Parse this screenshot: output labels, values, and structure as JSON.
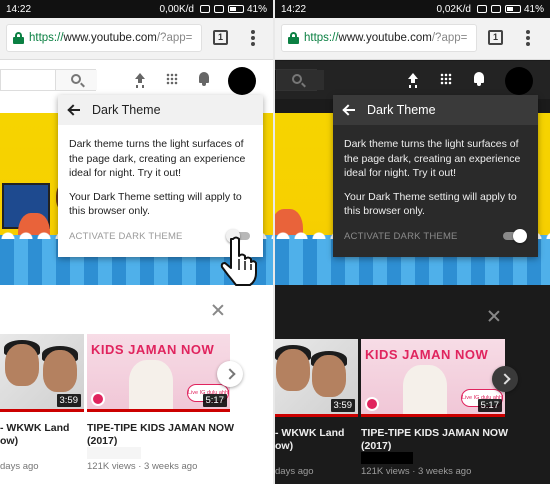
{
  "status_left": {
    "time": "14:22",
    "net_speed": "0,00K/d",
    "battery": "41%"
  },
  "status_right": {
    "time": "14:22",
    "net_speed": "0,02K/d",
    "battery": "41%"
  },
  "browser": {
    "url_scheme": "https://",
    "url_host": "www.youtube.com",
    "url_path": "/?app=",
    "tab_count": "1"
  },
  "popup": {
    "title": "Dark Theme",
    "body_1": "Dark theme turns the light surfaces of the page dark, creating an experience ideal for night. Try it out!",
    "body_2": "Your Dark Theme setting will apply to this browser only.",
    "toggle_label": "ACTIVATE DARK THEME"
  },
  "toggle_state": {
    "left": "off",
    "right": "on"
  },
  "videos_left": [
    {
      "duration": "3:59",
      "title_line1": "- WKWK Land",
      "title_line2": "ow)",
      "meta": "days ago"
    },
    {
      "duration": "5:17",
      "title_line1": "TIPE-TIPE KIDS JAMAN NOW",
      "title_line2": "(2017)",
      "meta": "121K views · 3 weeks ago"
    }
  ],
  "videos_right": [
    {
      "duration": "3:59",
      "title_line1": "- WKWK Land",
      "title_line2": "ow)",
      "meta": "days ago"
    },
    {
      "duration": "5:17",
      "title_line1": "TIPE-TIPE KIDS JAMAN NOW",
      "title_line2": "(2017)",
      "meta": "121K views · 3 weeks ago"
    }
  ],
  "thumb2_title": "KIDS JAMAN NOW",
  "thumb2_bubble": "Live IG dulu ahh!",
  "colors": {
    "url_green": "#0b8043",
    "yt_red": "#cc0000",
    "kids_pink": "#e0245e",
    "banner_yellow": "#f6d400"
  }
}
